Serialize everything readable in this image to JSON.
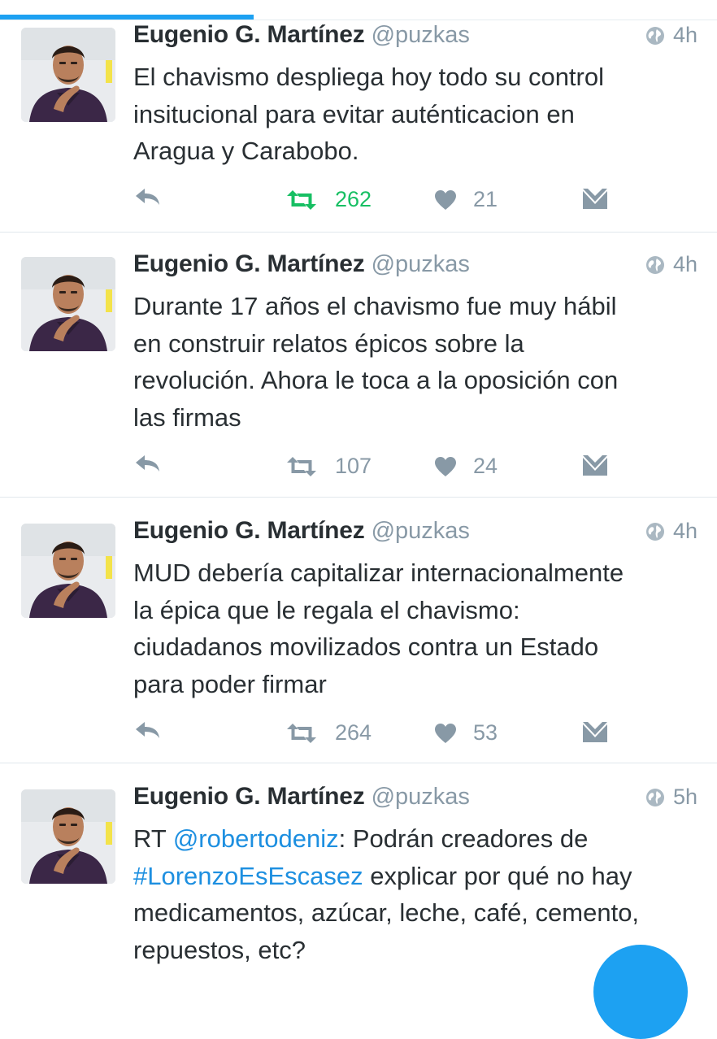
{
  "colors": {
    "accent": "#1da1f2",
    "retweet_active": "#17bf63",
    "muted": "#8899a6",
    "text": "#292f33",
    "link": "#1d8fe0"
  },
  "tweets": [
    {
      "name": "Eugenio G. Martínez",
      "handle": "@puzkas",
      "time": "4h",
      "text_lines": [
        "El chavismo despliega hoy todo su control",
        "insitucional para evitar auténticacion en",
        "Aragua y Carabobo."
      ],
      "retweets": "262",
      "retweeted": true,
      "likes": "21"
    },
    {
      "name": "Eugenio G. Martínez",
      "handle": "@puzkas",
      "time": "4h",
      "text_lines": [
        "Durante 17 años el chavismo fue muy hábil",
        "en construir relatos épicos sobre la",
        "revolución. Ahora le toca a la oposición con",
        "las firmas"
      ],
      "retweets": "107",
      "retweeted": false,
      "likes": "24"
    },
    {
      "name": "Eugenio G. Martínez",
      "handle": "@puzkas",
      "time": "4h",
      "text_lines": [
        "MUD debería capitalizar internacionalmente",
        "la épica que le regala el chavismo:",
        "ciudadanos movilizados contra un Estado",
        "para poder firmar"
      ],
      "retweets": "264",
      "retweeted": false,
      "likes": "53"
    },
    {
      "name": "Eugenio G. Martínez",
      "handle": "@puzkas",
      "time": "5h",
      "text": {
        "rt_prefix": "RT ",
        "mention": "@robertodeniz",
        "after_mention": ": Podrán creadores de",
        "hashtag": "#LorenzoEsEscasez",
        "after_hashtag": " explicar por qué no hay",
        "line3": "medicamentos, azúcar, leche, café, cemento,",
        "line4": "repuestos, etc?"
      }
    }
  ],
  "icons": {
    "reply": "reply-icon",
    "retweet": "retweet-icon",
    "like": "heart-icon",
    "dm": "envelope-icon",
    "globe": "globe-icon",
    "compose": "compose-fab"
  }
}
